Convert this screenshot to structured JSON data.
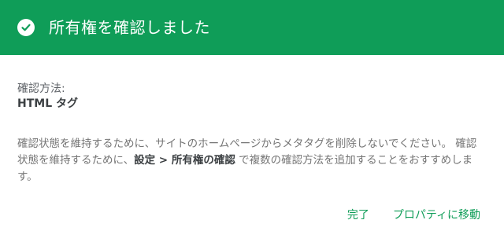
{
  "dialog": {
    "title": "所有権を確認しました",
    "header_color": "#0f9d58",
    "icon": "check-circle-icon"
  },
  "method": {
    "label": "確認方法:",
    "value": "HTML タグ"
  },
  "description": {
    "part1": "確認状態を維持するために、サイトのホームページからメタタグを削除しないでください。 確認状態を維持するために、",
    "path": "設定 > 所有権の確認",
    "part2": " で複数の確認方法を追加することをおすすめします。"
  },
  "actions": {
    "done_label": "完了",
    "go_to_property_label": "プロパティに移動",
    "accent_color": "#0f9d58"
  }
}
